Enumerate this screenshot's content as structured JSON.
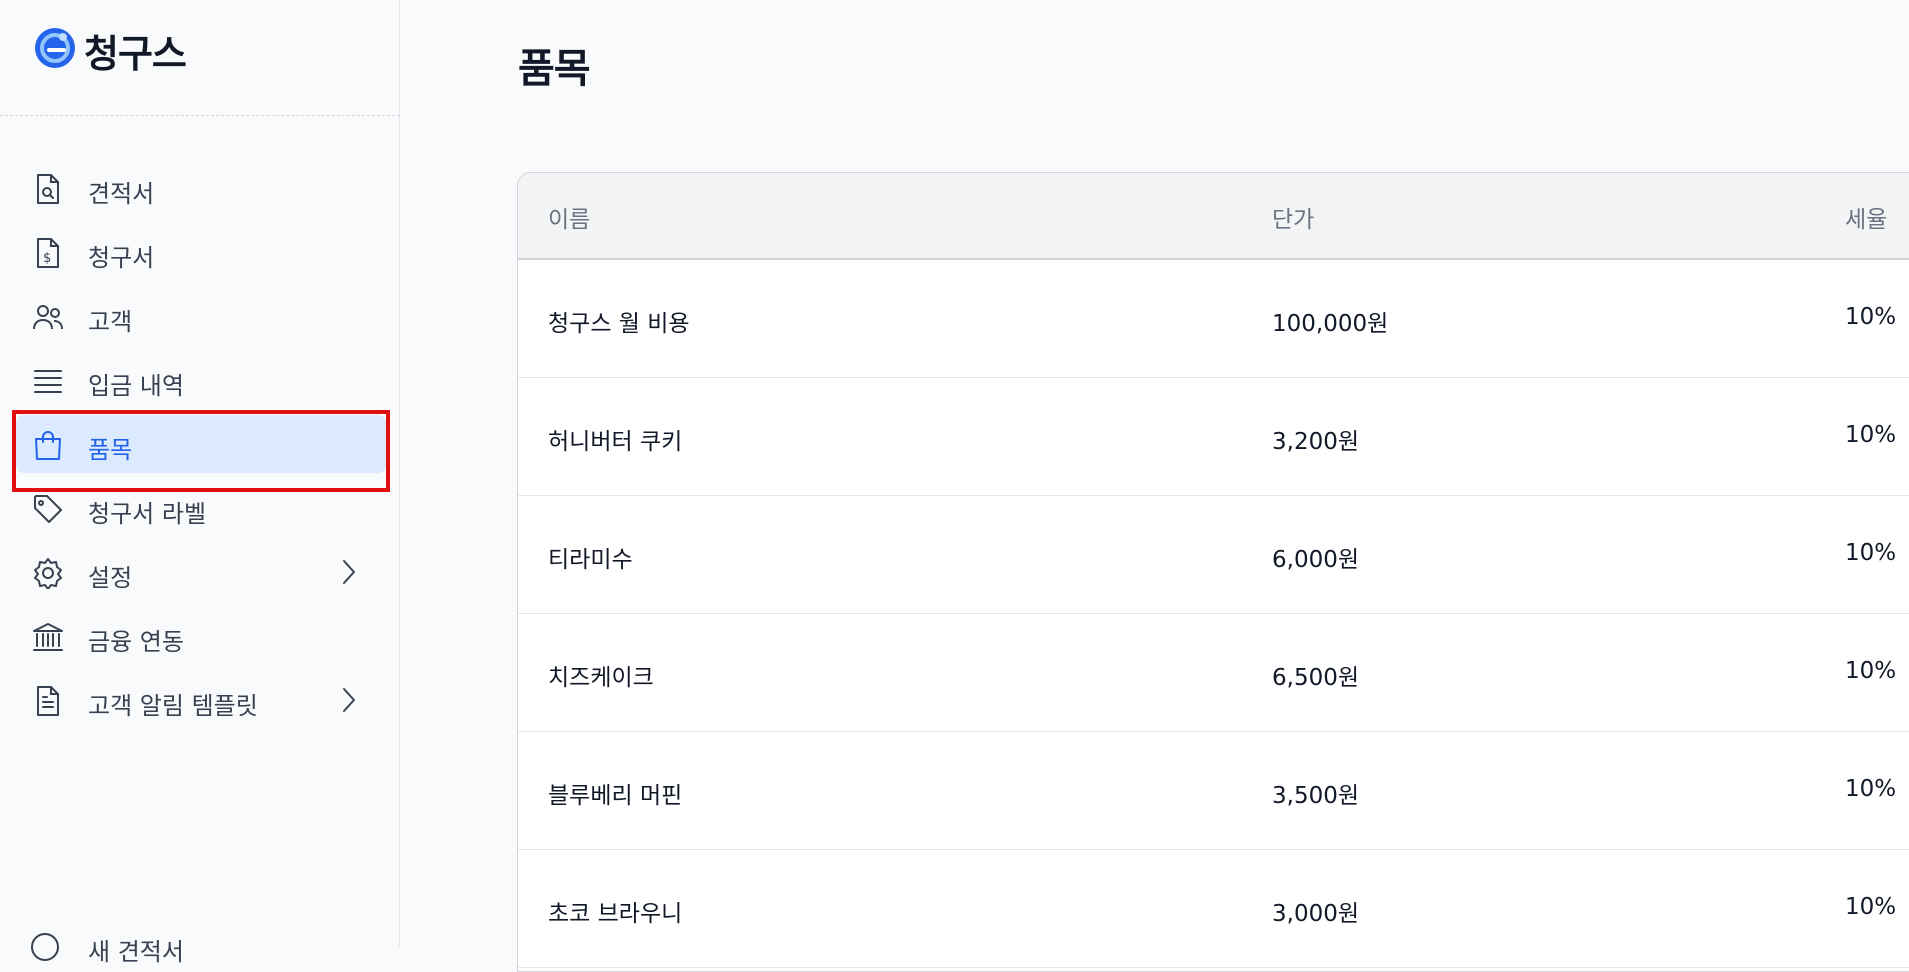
{
  "brand": {
    "name": "청구스",
    "logo_icon": "brand-logo-icon",
    "accent": "#2563eb"
  },
  "sidebar": {
    "items": [
      {
        "label": "견적서",
        "icon": "quote-document-icon"
      },
      {
        "label": "청구서",
        "icon": "invoice-dollar-icon"
      },
      {
        "label": "고객",
        "icon": "users-icon"
      },
      {
        "label": "입금 내역",
        "icon": "list-lines-icon"
      },
      {
        "label": "품목",
        "icon": "shopping-bag-icon",
        "active": true
      },
      {
        "label": "청구서 라벨",
        "icon": "tag-icon"
      },
      {
        "label": "설정",
        "icon": "gear-icon",
        "has_submenu": true
      },
      {
        "label": "금융 연동",
        "icon": "bank-icon"
      },
      {
        "label": "고객 알림 템플릿",
        "icon": "document-text-icon",
        "has_submenu": true
      }
    ],
    "footer_label": "새 견적서",
    "active_color": "#2563eb",
    "active_bg": "#dbeafe"
  },
  "main": {
    "title": "품목",
    "table": {
      "columns": [
        "이름",
        "단가",
        "세율"
      ],
      "rows": [
        {
          "name": "청구스 월 비용",
          "price": "100,000원",
          "tax": "10%"
        },
        {
          "name": "허니버터 쿠키",
          "price": "3,200원",
          "tax": "10%"
        },
        {
          "name": "티라미수",
          "price": "6,000원",
          "tax": "10%"
        },
        {
          "name": "치즈케이크",
          "price": "6,500원",
          "tax": "10%"
        },
        {
          "name": "블루베리 머핀",
          "price": "3,500원",
          "tax": "10%"
        },
        {
          "name": "초코 브라우니",
          "price": "3,000원",
          "tax": "10%"
        }
      ]
    }
  }
}
